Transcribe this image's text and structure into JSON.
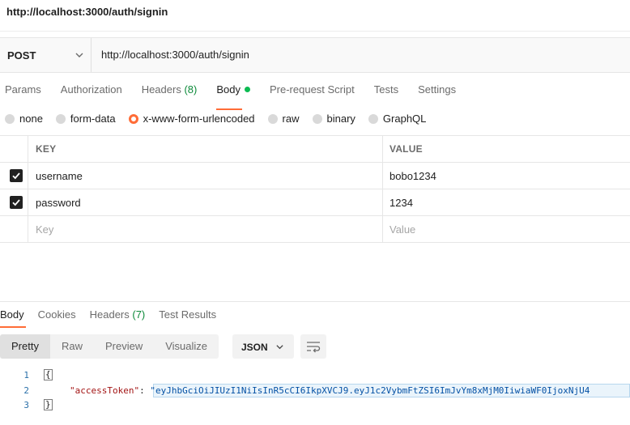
{
  "title": "http://localhost:3000/auth/signin",
  "request": {
    "method": "POST",
    "url": "http://localhost:3000/auth/signin"
  },
  "tabs": {
    "params": "Params",
    "authorization": "Authorization",
    "headers": "Headers",
    "headers_count": "(8)",
    "body": "Body",
    "prerequest": "Pre-request Script",
    "tests": "Tests",
    "settings": "Settings"
  },
  "body_types": {
    "none": "none",
    "form_data": "form-data",
    "urlencoded": "x-www-form-urlencoded",
    "raw": "raw",
    "binary": "binary",
    "graphql": "GraphQL",
    "selected": "x-www-form-urlencoded"
  },
  "params_table": {
    "headers": [
      "KEY",
      "VALUE"
    ],
    "rows": [
      {
        "key": "username",
        "value": "bobo1234",
        "checked": true
      },
      {
        "key": "password",
        "value": "1234",
        "checked": true
      }
    ],
    "placeholder_key": "Key",
    "placeholder_value": "Value"
  },
  "response": {
    "tabs": {
      "body": "Body",
      "cookies": "Cookies",
      "headers": "Headers",
      "headers_count": "(7)",
      "test_results": "Test Results"
    },
    "view_modes": [
      "Pretty",
      "Raw",
      "Preview",
      "Visualize"
    ],
    "active_view": "Pretty",
    "format": "JSON",
    "lines": {
      "n1": "1",
      "n2": "2",
      "n3": "3",
      "open_brace": "{",
      "close_brace": "}",
      "key": "\"accessToken\"",
      "colon": ": ",
      "value": "\"eyJhbGciOiJIUzI1NiIsInR5cCI6IkpXVCJ9.eyJ1c2VybmFtZSI6ImJvYm8xMjM0IiwiaWF0IjoxNjU4"
    }
  },
  "colors": {
    "accent": "#ff6c37",
    "active_dot": "#0cbb52",
    "json_key": "#a31515",
    "json_string": "#0451a5"
  }
}
